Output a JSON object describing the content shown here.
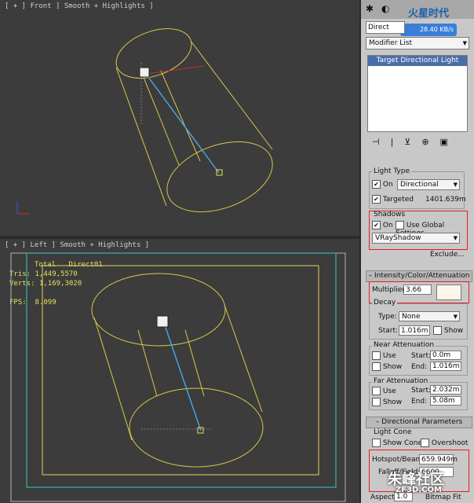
{
  "viewport_top": {
    "label": "[ + ] Front ] Smooth + Highlights ]"
  },
  "viewport_bottom": {
    "label": "[ + ] Left ] Smooth + Highlights ]",
    "stats": {
      "header_total": "Total",
      "header_obj": "Direct01",
      "tris_label": "Tris:",
      "tris_value": "1,449,5570",
      "verts_label": "Verts:",
      "verts_value": "1,169,3020",
      "fps_label": "FPS:",
      "fps_value": "8.099"
    }
  },
  "panel": {
    "object_name": "Direct",
    "speed_badge": "28.40 KB/s",
    "watermark_top": "火星时代",
    "modifier_list": "Modifier List",
    "stack_item": "Target Directional Light",
    "light_type": {
      "title": "Light Type",
      "on_label": "On",
      "type_value": "Directional",
      "targeted_label": "Targeted",
      "targeted_value": "1401.639m"
    },
    "shadows": {
      "title": "Shadows",
      "on_label": "On",
      "global_label": "Use Global Settings",
      "type_value": "VRayShadow",
      "exclude_label": "Exclude..."
    },
    "intensity": {
      "rollout": "Intensity/Color/Attenuation",
      "multiplier_label": "Multiplier:",
      "multiplier_value": "3.66",
      "decay_title": "Decay",
      "type_label": "Type:",
      "type_value": "None",
      "start_label": "Start:",
      "start_value": "1.016m",
      "show_label": "Show"
    },
    "near": {
      "title": "Near Attenuation",
      "use_label": "Use",
      "start_label": "Start:",
      "start_value": "0.0m",
      "show_label": "Show",
      "end_label": "End:",
      "end_value": "1.016m"
    },
    "far": {
      "title": "Far Attenuation",
      "use_label": "Use",
      "start_label": "Start:",
      "start_value": "2.032m",
      "show_label": "Show",
      "end_label": "End:",
      "end_value": "5.08m"
    },
    "directional": {
      "rollout": "Directional Parameters",
      "cone_title": "Light Cone",
      "show_cone_label": "Show Cone",
      "overshoot_label": "Overshoot",
      "hotspot_label": "Hotspot/Beam:",
      "hotspot_value": "659.949m",
      "falloff_label": "Falloff/Field:",
      "falloff_value": "6600",
      "aspect_label": "Aspect:",
      "aspect_value": "1.0",
      "bitmap_fit_label": "Bitmap Fit"
    },
    "watermark_bottom": "朱峰社区",
    "watermark_url": "ZF3D.COM"
  },
  "colors": {
    "accent_red": "#e02020",
    "wire_yellow": "#d8c84a",
    "light_blue": "#4aa8e8",
    "safe_frame_cyan": "#38c8c8",
    "swatch": "#fff5e8"
  }
}
